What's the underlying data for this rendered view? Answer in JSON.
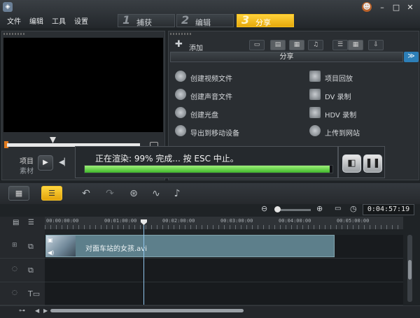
{
  "menu": [
    "文件",
    "编辑",
    "工具",
    "设置"
  ],
  "steps": [
    {
      "num": "1",
      "label": "捕获"
    },
    {
      "num": "2",
      "label": "编辑"
    },
    {
      "num": "3",
      "label": "分享"
    }
  ],
  "preview": {
    "project_label": "项目",
    "clip_label": "素材"
  },
  "share": {
    "add_label": "添加",
    "header": "分享",
    "collapse_glyph": "≫",
    "left_items": [
      "创建视频文件",
      "创建声音文件",
      "创建光盘",
      "导出到移动设备"
    ],
    "right_items": [
      "项目回放",
      "DV 录制",
      "HDV 录制",
      "上传到网站"
    ]
  },
  "render": {
    "message": "正在渲染: 99% 完成... 按 ESC 中止。",
    "progress_fraction": 0.99
  },
  "timeline": {
    "timecode": "0:04:57:19",
    "ruler_labels": [
      "00:00:00:00",
      "00:01:00:00",
      "00:02:00:00",
      "00:03:00:00",
      "00:04:00:00",
      "00:05:00:00"
    ],
    "clip_name": "对面车站的女孩.avi"
  },
  "colors": {
    "accent": "#f2b81a",
    "progress": "#55c83a",
    "clip": "#5d7f8b"
  }
}
